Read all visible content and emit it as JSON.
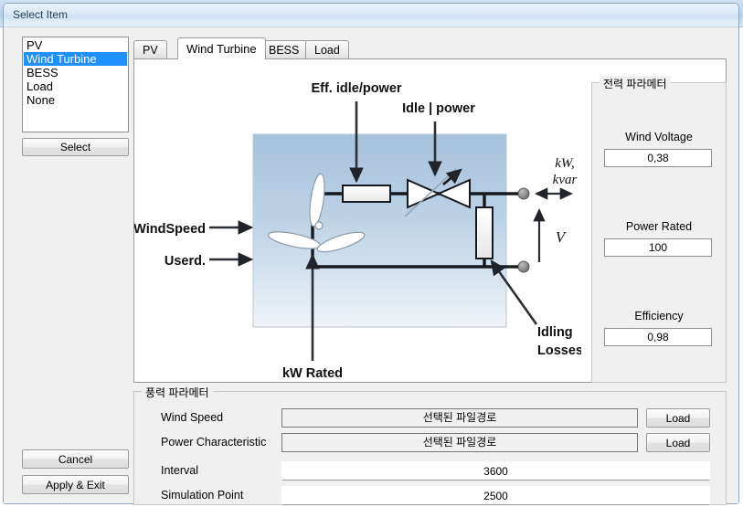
{
  "background_window": {
    "title": "··· ··· ··· ··· ·······"
  },
  "dialog": {
    "title": "Select Item"
  },
  "sidebar": {
    "list": {
      "items": [
        {
          "label": "PV",
          "selected": false
        },
        {
          "label": "Wind Turbine",
          "selected": true
        },
        {
          "label": "BESS",
          "selected": false
        },
        {
          "label": "Load",
          "selected": false
        },
        {
          "label": "None",
          "selected": false
        }
      ]
    },
    "select_button": "Select",
    "cancel_button": "Cancel",
    "apply_button": "Apply & Exit"
  },
  "tabs": [
    {
      "label": "PV",
      "active": false
    },
    {
      "label": "Wind Turbine",
      "active": true
    },
    {
      "label": "BESS",
      "active": false
    },
    {
      "label": "Load",
      "active": false
    }
  ],
  "diagram": {
    "labels": {
      "eff_idle_power": "Eff. idle/power",
      "idle_power": "Idle | power",
      "wind_speed": "WindSpeed",
      "userd": "Userd.",
      "kw_rated": "kW Rated",
      "idling": "Idling",
      "losses": "Losses",
      "kw": "kW,",
      "kvar": "kvar",
      "voltage": "V"
    },
    "colors": {
      "box_top": "#a9c4de",
      "box_bottom": "#eef2f6",
      "wire": "#1a1a1a",
      "node": "#8e8e8e"
    }
  },
  "power_group": {
    "caption": "전력 파라메터",
    "fields": [
      {
        "label": "Wind Voltage",
        "value": "0,38"
      },
      {
        "label": "Power Rated",
        "value": "100"
      },
      {
        "label": "Efficiency",
        "value": "0,98"
      }
    ]
  },
  "wind_group": {
    "caption": "풍력 파라메터",
    "rows": [
      {
        "label": "Wind Speed",
        "value": "선택된 파일경로",
        "type": "path",
        "button": "Load"
      },
      {
        "label": "Power Characteristic",
        "value": "선택된 파일경로",
        "type": "path",
        "button": "Load"
      },
      {
        "label": "Interval",
        "value": "3600",
        "type": "value",
        "button": ""
      },
      {
        "label": "Simulation Point",
        "value": "2500",
        "type": "value",
        "button": ""
      }
    ]
  }
}
